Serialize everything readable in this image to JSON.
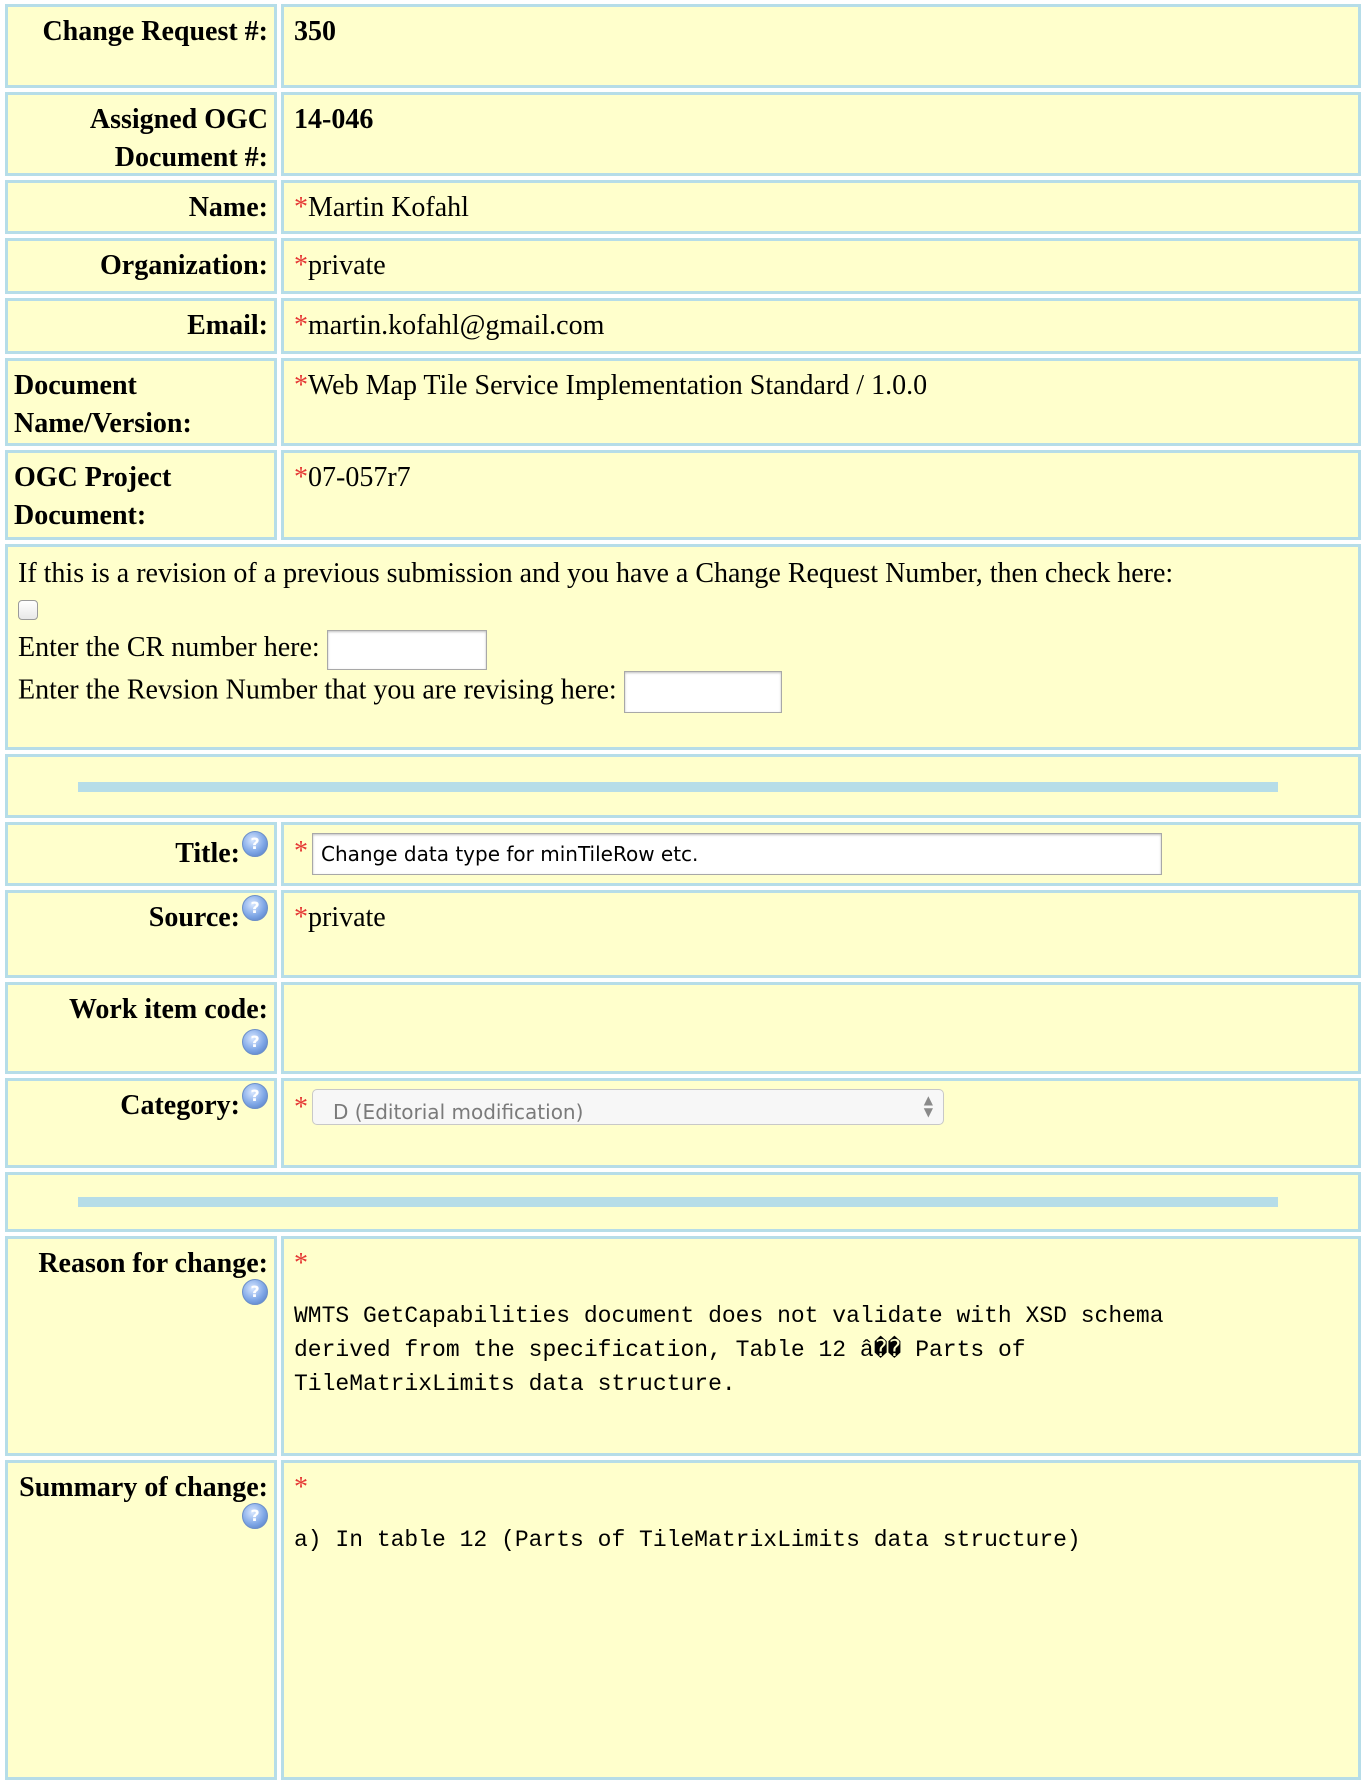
{
  "fields": {
    "cr_number": {
      "label": "Change Request #:",
      "value": "350"
    },
    "assigned_doc": {
      "label": "Assigned OGC Document #:",
      "value": "14-046"
    },
    "name": {
      "label": "Name:",
      "value": "Martin Kofahl"
    },
    "organization": {
      "label": "Organization:",
      "value": "private"
    },
    "email": {
      "label": "Email:",
      "value": "martin.kofahl@gmail.com"
    },
    "doc_name_version": {
      "label": "Document Name/Version:",
      "value": "Web Map Tile Service Implementation Standard / 1.0.0"
    },
    "ogc_project_doc": {
      "label": "OGC Project Document:",
      "value": "07-057r7"
    }
  },
  "revision": {
    "prompt": "If this is a revision of a previous submission and you have a Change Request Number, then check here:",
    "cr_label": "Enter the CR number here:",
    "rev_label": "Enter the Revsion Number that you are revising here:",
    "cr_value": "",
    "rev_value": ""
  },
  "title": {
    "label": "Title:",
    "value": "Change data type for minTileRow etc."
  },
  "source": {
    "label": "Source:",
    "value": "private"
  },
  "work_item": {
    "label": "Work item code:",
    "value": ""
  },
  "category": {
    "label": "Category:",
    "selected": "D (Editorial modification)"
  },
  "reason": {
    "label": "Reason for change:",
    "text": "WMTS GetCapabilities document does not validate with XSD schema\nderived from the specification, Table 12 â�� Parts of\nTileMatrixLimits data structure."
  },
  "summary": {
    "label": "Summary of change:",
    "text": "a) In table 12 (Parts of TileMatrixLimits data structure)"
  },
  "required_marker": "*",
  "icons": {
    "help": "help-question-icon",
    "select_arrows": "updown-arrows-icon"
  },
  "colors": {
    "cell_bg": "#ffffcc",
    "border": "#b6dde8",
    "required": "#e53935"
  }
}
